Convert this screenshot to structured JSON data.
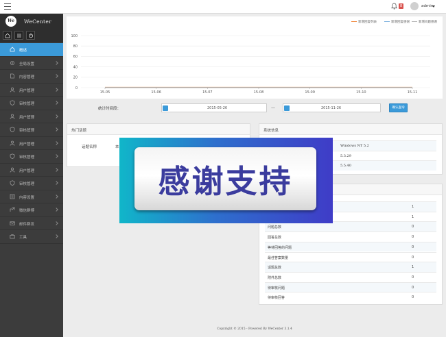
{
  "topbar": {
    "notification_count": "8",
    "username": "admin"
  },
  "sidebar": {
    "logo_short": "We",
    "logo_text": "WeCenter",
    "items": [
      {
        "label": "概述",
        "icon": "home-icon"
      },
      {
        "label": "全局设置",
        "icon": "gear-icon"
      },
      {
        "label": "内容管理",
        "icon": "document-icon"
      },
      {
        "label": "用户管理",
        "icon": "user-icon"
      },
      {
        "label": "审核管理",
        "icon": "shield-icon"
      },
      {
        "label": "用户管理",
        "icon": "user-icon"
      },
      {
        "label": "审核管理",
        "icon": "shield-icon"
      },
      {
        "label": "用户管理",
        "icon": "user-icon"
      },
      {
        "label": "审核管理",
        "icon": "shield-icon"
      },
      {
        "label": "用户管理",
        "icon": "user-icon"
      },
      {
        "label": "审核管理",
        "icon": "shield-icon"
      },
      {
        "label": "内容设置",
        "icon": "list-icon"
      },
      {
        "label": "微信群博",
        "icon": "share-icon"
      },
      {
        "label": "邮件群发",
        "icon": "mail-icon"
      },
      {
        "label": "工具",
        "icon": "briefcase-icon"
      }
    ]
  },
  "chart_data": {
    "type": "line",
    "categories": [
      "15-05",
      "15-06",
      "15-07",
      "15-08",
      "15-09",
      "15-10",
      "15-11"
    ],
    "ylim": [
      0,
      100
    ],
    "yticks": [
      0,
      20,
      40,
      60,
      80,
      100
    ],
    "legend_position": "top-right",
    "grid": true,
    "series": [
      {
        "name": "新增回复列表",
        "color": "#f0883e",
        "values": [
          0,
          0,
          0,
          0,
          0,
          0,
          0
        ]
      },
      {
        "name": "新增回复感谢",
        "color": "#7fb3e0",
        "values": [
          0,
          0,
          0,
          0,
          0,
          0,
          0
        ]
      },
      {
        "name": "新增问题感谢",
        "color": "#b6b6b6",
        "values": [
          0,
          0,
          0,
          0,
          0,
          0,
          0
        ]
      }
    ]
  },
  "date_filter": {
    "label": "统计时间段：",
    "start": "2015-05-26",
    "end": "2015-11-26",
    "confirm_label": "确认查询"
  },
  "hot_topics": {
    "title": "热门话题",
    "col1": "话题名称",
    "col2": "本"
  },
  "system_info": {
    "title": "系统信息",
    "rows": [
      {
        "value": "Windows NT 5.2"
      },
      {
        "value": "5.3.29"
      },
      {
        "value": "5.5.40"
      }
    ]
  },
  "stats": {
    "rows": [
      {
        "key": "",
        "value": "1"
      },
      {
        "key": "",
        "value": "1"
      },
      {
        "key": "问题总数",
        "value": "0"
      },
      {
        "key": "回答总数",
        "value": "0"
      },
      {
        "key": "等待回答的问题",
        "value": "0"
      },
      {
        "key": "最佳答案数量",
        "value": "0"
      },
      {
        "key": "话题总数",
        "value": "1"
      },
      {
        "key": "附件总数",
        "value": "0"
      },
      {
        "key": "待审核问题",
        "value": "0"
      },
      {
        "key": "待审核回答",
        "value": "0"
      }
    ]
  },
  "footer": {
    "text": "Copyright © 2015 - Powered By WeCenter 3.1.4"
  },
  "banner": {
    "text": "感谢支持"
  }
}
